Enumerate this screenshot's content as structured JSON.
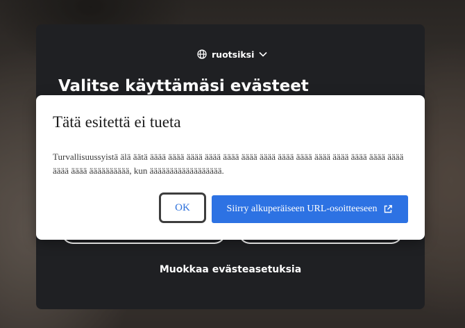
{
  "cookie_panel": {
    "language_label": "ruotsiksi",
    "title": "Valitse käyttämäsi evästeet",
    "settings_link": "Muokkaa evästeasetuksia"
  },
  "dialog": {
    "title": "Tätä esitettä ei tueta",
    "message": "Turvallisuussyistä älä äätä ääää ääää ääää ääää ääää ääää ääää ääää ääää ääää ääää ääää ääää ääää ääää ääää ääääääääää, kun ääääääääääääääääää.",
    "ok_label": "OK",
    "open_original_label": "Siirry alkuperäiseen URL-osoitteeseen"
  },
  "colors": {
    "panel_background": "#1f2023",
    "primary_button": "#2d72e3",
    "ok_text": "#2a6fdb"
  },
  "icons": {
    "language": "globe-icon",
    "dropdown": "chevron-down-icon",
    "external": "external-link-icon"
  }
}
